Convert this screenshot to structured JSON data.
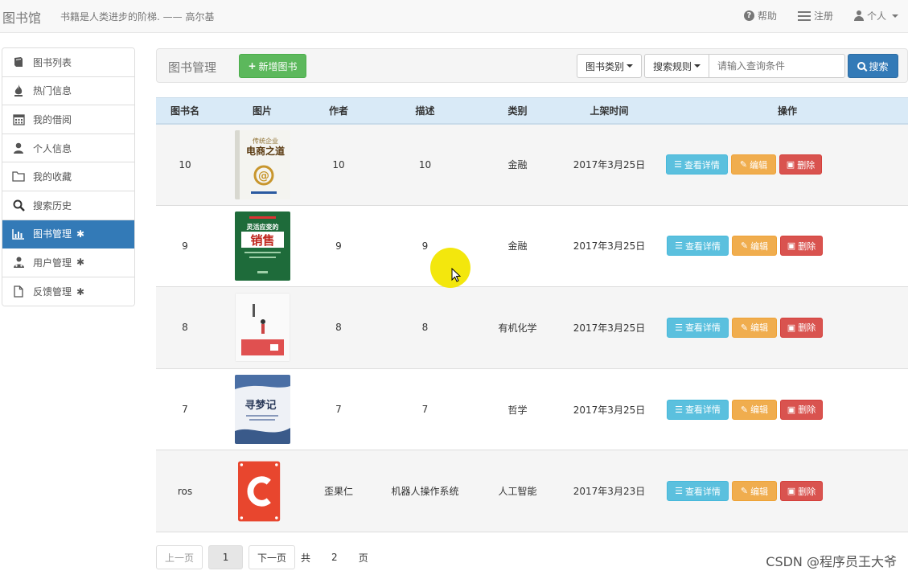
{
  "navbar": {
    "brand": "图书馆",
    "motto": "书籍是人类进步的阶梯. —— 高尔基",
    "links": {
      "help": "帮助",
      "register": "注册",
      "personal": "个人"
    }
  },
  "sidebar": {
    "items": [
      {
        "label": "图书列表",
        "icon": "book-icon"
      },
      {
        "label": "热门信息",
        "icon": "fire-icon"
      },
      {
        "label": "我的借阅",
        "icon": "calendar-icon"
      },
      {
        "label": "个人信息",
        "icon": "user-icon"
      },
      {
        "label": "我的收藏",
        "icon": "folder-icon"
      },
      {
        "label": "搜索历史",
        "icon": "search-icon"
      },
      {
        "label": "图书管理",
        "icon": "chart-icon",
        "active": true
      },
      {
        "label": "用户管理",
        "icon": "users-icon"
      },
      {
        "label": "反馈管理",
        "icon": "file-icon"
      }
    ]
  },
  "toolbar": {
    "title": "图书管理",
    "add_label": "新增图书",
    "category_label": "图书类别",
    "rule_label": "搜索规则",
    "search_placeholder": "请输入查询条件",
    "search_label": "搜索"
  },
  "table": {
    "headers": [
      "图书名",
      "图片",
      "作者",
      "描述",
      "类别",
      "上架时间",
      "操作"
    ],
    "rows": [
      {
        "name": "10",
        "author": "10",
        "desc": "10",
        "category": "金融",
        "date": "2017年3月25日",
        "cover": "ecommerce"
      },
      {
        "name": "9",
        "author": "9",
        "desc": "9",
        "category": "金融",
        "date": "2017年3月25日",
        "cover": "sales"
      },
      {
        "name": "8",
        "author": "8",
        "desc": "8",
        "category": "有机化学",
        "date": "2017年3月25日",
        "cover": "white"
      },
      {
        "name": "7",
        "author": "7",
        "desc": "7",
        "category": "哲学",
        "date": "2017年3月25日",
        "cover": "blue"
      },
      {
        "name": "ros",
        "author": "歪果仁",
        "desc": "机器人操作系统",
        "category": "人工智能",
        "date": "2017年3月23日",
        "cover": "red"
      }
    ],
    "actions": {
      "detail": "查看详情",
      "edit": "编辑",
      "delete": "删除"
    }
  },
  "pager": {
    "prev": "上一页",
    "current": "1",
    "next": "下一页",
    "total_prefix": "共",
    "total_pages": "2",
    "total_suffix": "页"
  },
  "covers": {
    "ecommerce": {
      "line1": "传统企业",
      "line2": "电商之道"
    },
    "sales": {
      "line1": "灵活应变的",
      "line2": "销售"
    },
    "blue": {
      "line1": "寻梦记"
    }
  },
  "watermark": "CSDN @程序员王大爷",
  "colors": {
    "primary": "#337ab7",
    "success": "#5cb85c",
    "info": "#5bc0de",
    "warning": "#f0ad4e",
    "danger": "#d9534f",
    "header_bg": "#d9eaf7"
  }
}
